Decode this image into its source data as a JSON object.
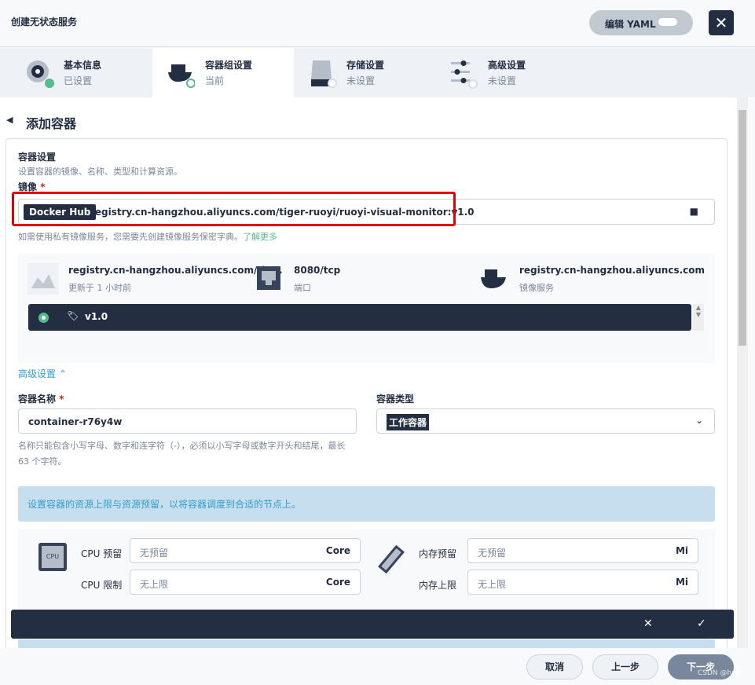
{
  "header": {
    "title": "创建无状态服务",
    "yaml_label": "编辑 YAML",
    "close": "✕"
  },
  "steps": [
    {
      "title": "基本信息",
      "status": "已设置"
    },
    {
      "title": "容器组设置",
      "status": "当前"
    },
    {
      "title": "存储设置",
      "status": "未设置"
    },
    {
      "title": "高级设置",
      "status": "未设置"
    }
  ],
  "page": {
    "back_title": "添加容器"
  },
  "container_settings": {
    "title": "容器设置",
    "desc": "设置容器的镜像、名称、类型和计算资源。",
    "image_label": "镜像",
    "required": "*",
    "registry": "Docker Hub",
    "image_value": "registry.cn-hangzhou.aliyuncs.com/tiger-ruoyi/ruoyi-visual-monitor:v1.0",
    "hint": "如需使用私有镜像服务，您需要先创建镜像服务保密字典。",
    "hint_link": "了解更多"
  },
  "image_info": {
    "name": "registry.cn-hangzhou.aliyuncs.com/tig...",
    "updated": "更新于 1 小时前",
    "port": "8080/tcp",
    "port_label": "端口",
    "registry": "registry.cn-hangzhou.aliyuncs.com",
    "registry_label": "镜像服务",
    "tag": "v1.0"
  },
  "advanced": {
    "toggle": "高级设置"
  },
  "name_field": {
    "label": "容器名称",
    "required": "*",
    "value": "container-r76y4w",
    "hint": "名称只能包含小写字母、数字和连字符（-），必须以小写字母或数字开头和结尾，最长 63 个字符。"
  },
  "type_field": {
    "label": "容器类型",
    "value": "工作容器"
  },
  "resources": {
    "notice": "设置容器的资源上限与资源预留，以将容器调度到合适的节点上。",
    "cpu_icon_text": "CPU",
    "cpu_request_label": "CPU 预留",
    "cpu_request_placeholder": "无预留",
    "cpu_unit": "Core",
    "cpu_limit_label": "CPU 限制",
    "cpu_limit_placeholder": "无上限",
    "mem_request_label": "内存预留",
    "mem_request_placeholder": "无预留",
    "mem_unit": "Mi",
    "mem_limit_label": "内存上限",
    "mem_limit_placeholder": "无上限"
  },
  "bar": {
    "cancel": "✕",
    "confirm": "✓"
  },
  "footer": {
    "cancel": "取消",
    "prev": "上一步",
    "next": "下一步",
    "watermark": "CSDN @hrzz"
  },
  "colors": {
    "primary": "#242e42",
    "success": "#55bc8a",
    "link": "#55bc8a",
    "notice": "#c7deef",
    "highlight": "#e60000"
  }
}
